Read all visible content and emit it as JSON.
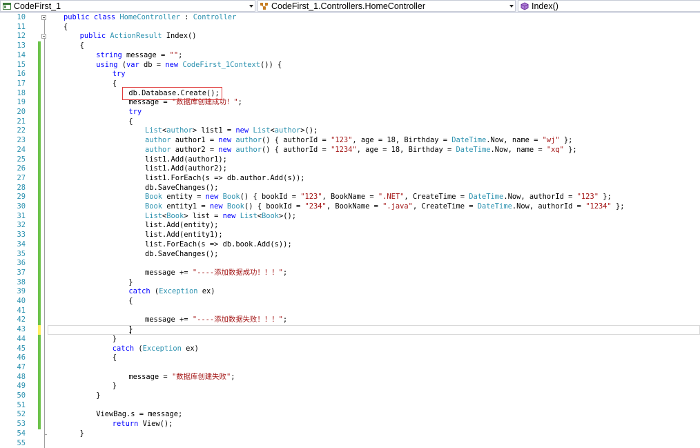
{
  "navbar": {
    "project": "CodeFirst_1",
    "class": "CodeFirst_1.Controllers.HomeController",
    "member": "Index()"
  },
  "code": {
    "first_line": 10,
    "lines": [
      {
        "indent": 2,
        "tokens": [
          [
            "kw",
            "public"
          ],
          [
            "p",
            " "
          ],
          [
            "kw",
            "class"
          ],
          [
            "p",
            " "
          ],
          [
            "type",
            "HomeController"
          ],
          [
            "p",
            " : "
          ],
          [
            "type",
            "Controller"
          ]
        ]
      },
      {
        "indent": 2,
        "tokens": [
          [
            "p",
            "{"
          ]
        ]
      },
      {
        "indent": 6,
        "tokens": [
          [
            "kw",
            "public"
          ],
          [
            "p",
            " "
          ],
          [
            "type",
            "ActionResult"
          ],
          [
            "p",
            " Index()"
          ]
        ]
      },
      {
        "indent": 6,
        "tokens": [
          [
            "p",
            "{"
          ]
        ]
      },
      {
        "indent": 10,
        "tokens": [
          [
            "kw",
            "string"
          ],
          [
            "p",
            " message = "
          ],
          [
            "str",
            "\"\""
          ],
          [
            "p",
            ";"
          ]
        ]
      },
      {
        "indent": 10,
        "tokens": [
          [
            "kw",
            "using"
          ],
          [
            "p",
            " ("
          ],
          [
            "kw",
            "var"
          ],
          [
            "p",
            " db = "
          ],
          [
            "kw",
            "new"
          ],
          [
            "p",
            " "
          ],
          [
            "type",
            "CodeFirst_1Context"
          ],
          [
            "p",
            "()) {"
          ]
        ]
      },
      {
        "indent": 14,
        "tokens": [
          [
            "kw",
            "try"
          ]
        ]
      },
      {
        "indent": 14,
        "tokens": [
          [
            "p",
            "{"
          ]
        ]
      },
      {
        "indent": 18,
        "tokens": [
          [
            "p",
            "db.Database.Create();"
          ]
        ]
      },
      {
        "indent": 18,
        "tokens": [
          [
            "p",
            "message = "
          ],
          [
            "str",
            "\"数据库创建成功！\""
          ],
          [
            "p",
            ";"
          ]
        ]
      },
      {
        "indent": 18,
        "tokens": [
          [
            "kw",
            "try"
          ]
        ]
      },
      {
        "indent": 18,
        "tokens": [
          [
            "p",
            "{"
          ]
        ]
      },
      {
        "indent": 22,
        "tokens": [
          [
            "type",
            "List"
          ],
          [
            "p",
            "<"
          ],
          [
            "type",
            "author"
          ],
          [
            "p",
            "> list1 = "
          ],
          [
            "kw",
            "new"
          ],
          [
            "p",
            " "
          ],
          [
            "type",
            "List"
          ],
          [
            "p",
            "<"
          ],
          [
            "type",
            "author"
          ],
          [
            "p",
            ">();"
          ]
        ]
      },
      {
        "indent": 22,
        "tokens": [
          [
            "type",
            "author"
          ],
          [
            "p",
            " author1 = "
          ],
          [
            "kw",
            "new"
          ],
          [
            "p",
            " "
          ],
          [
            "type",
            "author"
          ],
          [
            "p",
            "() { authorId = "
          ],
          [
            "str",
            "\"123\""
          ],
          [
            "p",
            ", age = 18, Birthday = "
          ],
          [
            "type",
            "DateTime"
          ],
          [
            "p",
            ".Now, name = "
          ],
          [
            "str",
            "\"wj\""
          ],
          [
            "p",
            " };"
          ]
        ]
      },
      {
        "indent": 22,
        "tokens": [
          [
            "type",
            "author"
          ],
          [
            "p",
            " author2 = "
          ],
          [
            "kw",
            "new"
          ],
          [
            "p",
            " "
          ],
          [
            "type",
            "author"
          ],
          [
            "p",
            "() { authorId = "
          ],
          [
            "str",
            "\"1234\""
          ],
          [
            "p",
            ", age = 18, Birthday = "
          ],
          [
            "type",
            "DateTime"
          ],
          [
            "p",
            ".Now, name = "
          ],
          [
            "str",
            "\"xq\""
          ],
          [
            "p",
            " };"
          ]
        ]
      },
      {
        "indent": 22,
        "tokens": [
          [
            "p",
            "list1.Add(author1);"
          ]
        ]
      },
      {
        "indent": 22,
        "tokens": [
          [
            "p",
            "list1.Add(author2);"
          ]
        ]
      },
      {
        "indent": 22,
        "tokens": [
          [
            "p",
            "list1.ForEach(s => db.author.Add(s));"
          ]
        ]
      },
      {
        "indent": 22,
        "tokens": [
          [
            "p",
            "db.SaveChanges();"
          ]
        ]
      },
      {
        "indent": 22,
        "tokens": [
          [
            "type",
            "Book"
          ],
          [
            "p",
            " entity = "
          ],
          [
            "kw",
            "new"
          ],
          [
            "p",
            " "
          ],
          [
            "type",
            "Book"
          ],
          [
            "p",
            "() { bookId = "
          ],
          [
            "str",
            "\"123\""
          ],
          [
            "p",
            ", BookName = "
          ],
          [
            "str",
            "\".NET\""
          ],
          [
            "p",
            ", CreateTime = "
          ],
          [
            "type",
            "DateTime"
          ],
          [
            "p",
            ".Now, authorId = "
          ],
          [
            "str",
            "\"123\""
          ],
          [
            "p",
            " };"
          ]
        ]
      },
      {
        "indent": 22,
        "tokens": [
          [
            "type",
            "Book"
          ],
          [
            "p",
            " entity1 = "
          ],
          [
            "kw",
            "new"
          ],
          [
            "p",
            " "
          ],
          [
            "type",
            "Book"
          ],
          [
            "p",
            "() { bookId = "
          ],
          [
            "str",
            "\"234\""
          ],
          [
            "p",
            ", BookName = "
          ],
          [
            "str",
            "\".java\""
          ],
          [
            "p",
            ", CreateTime = "
          ],
          [
            "type",
            "DateTime"
          ],
          [
            "p",
            ".Now, authorId = "
          ],
          [
            "str",
            "\"1234\""
          ],
          [
            "p",
            " };"
          ]
        ]
      },
      {
        "indent": 22,
        "tokens": [
          [
            "type",
            "List"
          ],
          [
            "p",
            "<"
          ],
          [
            "type",
            "Book"
          ],
          [
            "p",
            "> list = "
          ],
          [
            "kw",
            "new"
          ],
          [
            "p",
            " "
          ],
          [
            "type",
            "List"
          ],
          [
            "p",
            "<"
          ],
          [
            "type",
            "Book"
          ],
          [
            "p",
            ">();"
          ]
        ]
      },
      {
        "indent": 22,
        "tokens": [
          [
            "p",
            "list.Add(entity);"
          ]
        ]
      },
      {
        "indent": 22,
        "tokens": [
          [
            "p",
            "list.Add(entity1);"
          ]
        ]
      },
      {
        "indent": 22,
        "tokens": [
          [
            "p",
            "list.ForEach(s => db.book.Add(s));"
          ]
        ]
      },
      {
        "indent": 22,
        "tokens": [
          [
            "p",
            "db.SaveChanges();"
          ]
        ]
      },
      {
        "indent": 0,
        "tokens": []
      },
      {
        "indent": 22,
        "tokens": [
          [
            "p",
            "message += "
          ],
          [
            "str",
            "\"----添加数据成功！！！\""
          ],
          [
            "p",
            ";"
          ]
        ]
      },
      {
        "indent": 18,
        "tokens": [
          [
            "p",
            "}"
          ]
        ]
      },
      {
        "indent": 18,
        "tokens": [
          [
            "kw",
            "catch"
          ],
          [
            "p",
            " ("
          ],
          [
            "type",
            "Exception"
          ],
          [
            "p",
            " ex)"
          ]
        ]
      },
      {
        "indent": 18,
        "tokens": [
          [
            "p",
            "{"
          ]
        ]
      },
      {
        "indent": 0,
        "tokens": []
      },
      {
        "indent": 22,
        "tokens": [
          [
            "p",
            "message += "
          ],
          [
            "str",
            "\"----添加数据失败！！！\""
          ],
          [
            "p",
            ";"
          ]
        ]
      },
      {
        "indent": 18,
        "tokens": [
          [
            "p",
            "}"
          ]
        ]
      },
      {
        "indent": 14,
        "tokens": [
          [
            "p",
            "}"
          ]
        ]
      },
      {
        "indent": 14,
        "tokens": [
          [
            "kw",
            "catch"
          ],
          [
            "p",
            " ("
          ],
          [
            "type",
            "Exception"
          ],
          [
            "p",
            " ex)"
          ]
        ]
      },
      {
        "indent": 14,
        "tokens": [
          [
            "p",
            "{"
          ]
        ]
      },
      {
        "indent": 0,
        "tokens": []
      },
      {
        "indent": 18,
        "tokens": [
          [
            "p",
            "message = "
          ],
          [
            "str",
            "\"数据库创建失败\""
          ],
          [
            "p",
            ";"
          ]
        ]
      },
      {
        "indent": 14,
        "tokens": [
          [
            "p",
            "}"
          ]
        ]
      },
      {
        "indent": 10,
        "tokens": [
          [
            "p",
            "}"
          ]
        ]
      },
      {
        "indent": 0,
        "tokens": []
      },
      {
        "indent": 10,
        "tokens": [
          [
            "p",
            "ViewBag.s = message;"
          ]
        ]
      },
      {
        "indent": 14,
        "tokens": [
          [
            "kw",
            "return"
          ],
          [
            "p",
            " View();"
          ]
        ]
      },
      {
        "indent": 6,
        "tokens": [
          [
            "p",
            "}"
          ]
        ]
      },
      {
        "indent": 0,
        "tokens": []
      }
    ]
  },
  "colors": {
    "keyword": "#0000ff",
    "type": "#2b91af",
    "string": "#a31515",
    "line_number": "#2b91af",
    "change_saved": "#6cc24a",
    "change_unsaved": "#ffee62",
    "highlight_box": "#e03c3c"
  },
  "icons": {
    "project": "csharp-project-icon",
    "class": "class-icon",
    "member": "method-icon"
  }
}
